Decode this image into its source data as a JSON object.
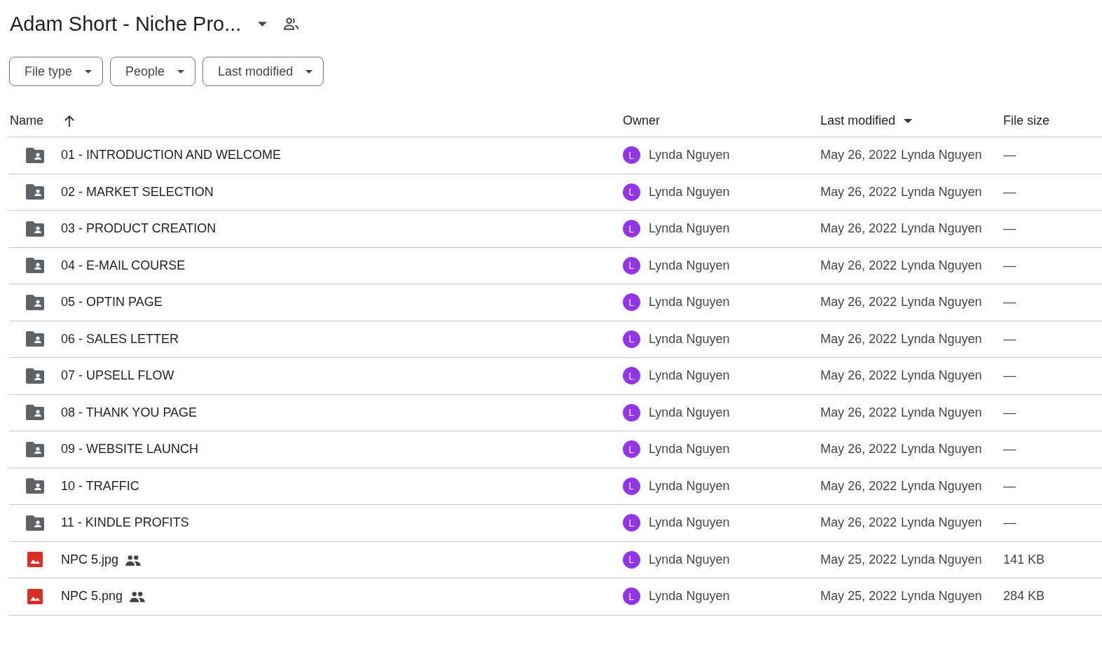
{
  "folder": {
    "title": "Adam Short - Niche Pro..."
  },
  "filters": [
    {
      "label": "File type"
    },
    {
      "label": "People"
    },
    {
      "label": "Last modified"
    }
  ],
  "table": {
    "columns": [
      {
        "label": "Name",
        "sorted": true,
        "descending": false
      },
      {
        "label": "Owner",
        "sorted": false
      },
      {
        "label": "Last modified",
        "sorted": true,
        "descending": true
      },
      {
        "label": "File size",
        "sorted": false
      }
    ],
    "rows": [
      {
        "kind": "folder",
        "name": "01 - INTRODUCTION AND WELCOME",
        "shared": false,
        "owner_initial": "L",
        "owner": "Lynda Nguyen",
        "date": "May 26, 2022",
        "modified_by": "Lynda Nguyen",
        "size": "—"
      },
      {
        "kind": "folder",
        "name": "02 - MARKET SELECTION",
        "shared": false,
        "owner_initial": "L",
        "owner": "Lynda Nguyen",
        "date": "May 26, 2022",
        "modified_by": "Lynda Nguyen",
        "size": "—"
      },
      {
        "kind": "folder",
        "name": "03 - PRODUCT CREATION",
        "shared": false,
        "owner_initial": "L",
        "owner": "Lynda Nguyen",
        "date": "May 26, 2022",
        "modified_by": "Lynda Nguyen",
        "size": "—"
      },
      {
        "kind": "folder",
        "name": "04 - E-MAIL COURSE",
        "shared": false,
        "owner_initial": "L",
        "owner": "Lynda Nguyen",
        "date": "May 26, 2022",
        "modified_by": "Lynda Nguyen",
        "size": "—"
      },
      {
        "kind": "folder",
        "name": "05 - OPTIN PAGE",
        "shared": false,
        "owner_initial": "L",
        "owner": "Lynda Nguyen",
        "date": "May 26, 2022",
        "modified_by": "Lynda Nguyen",
        "size": "—"
      },
      {
        "kind": "folder",
        "name": "06 - SALES LETTER",
        "shared": false,
        "owner_initial": "L",
        "owner": "Lynda Nguyen",
        "date": "May 26, 2022",
        "modified_by": "Lynda Nguyen",
        "size": "—"
      },
      {
        "kind": "folder",
        "name": "07 - UPSELL FLOW",
        "shared": false,
        "owner_initial": "L",
        "owner": "Lynda Nguyen",
        "date": "May 26, 2022",
        "modified_by": "Lynda Nguyen",
        "size": "—"
      },
      {
        "kind": "folder",
        "name": "08 - THANK YOU PAGE",
        "shared": false,
        "owner_initial": "L",
        "owner": "Lynda Nguyen",
        "date": "May 26, 2022",
        "modified_by": "Lynda Nguyen",
        "size": "—"
      },
      {
        "kind": "folder",
        "name": "09 - WEBSITE LAUNCH",
        "shared": false,
        "owner_initial": "L",
        "owner": "Lynda Nguyen",
        "date": "May 26, 2022",
        "modified_by": "Lynda Nguyen",
        "size": "—"
      },
      {
        "kind": "folder",
        "name": "10 - TRAFFIC",
        "shared": false,
        "owner_initial": "L",
        "owner": "Lynda Nguyen",
        "date": "May 26, 2022",
        "modified_by": "Lynda Nguyen",
        "size": "—"
      },
      {
        "kind": "folder",
        "name": "11 - KINDLE PROFITS",
        "shared": false,
        "owner_initial": "L",
        "owner": "Lynda Nguyen",
        "date": "May 26, 2022",
        "modified_by": "Lynda Nguyen",
        "size": "—"
      },
      {
        "kind": "image",
        "name": "NPC 5.jpg",
        "shared": true,
        "owner_initial": "L",
        "owner": "Lynda Nguyen",
        "date": "May 25, 2022",
        "modified_by": "Lynda Nguyen",
        "size": "141 KB"
      },
      {
        "kind": "image",
        "name": "NPC 5.png",
        "shared": true,
        "owner_initial": "L",
        "owner": "Lynda Nguyen",
        "date": "May 25, 2022",
        "modified_by": "Lynda Nguyen",
        "size": "284 KB"
      }
    ]
  }
}
